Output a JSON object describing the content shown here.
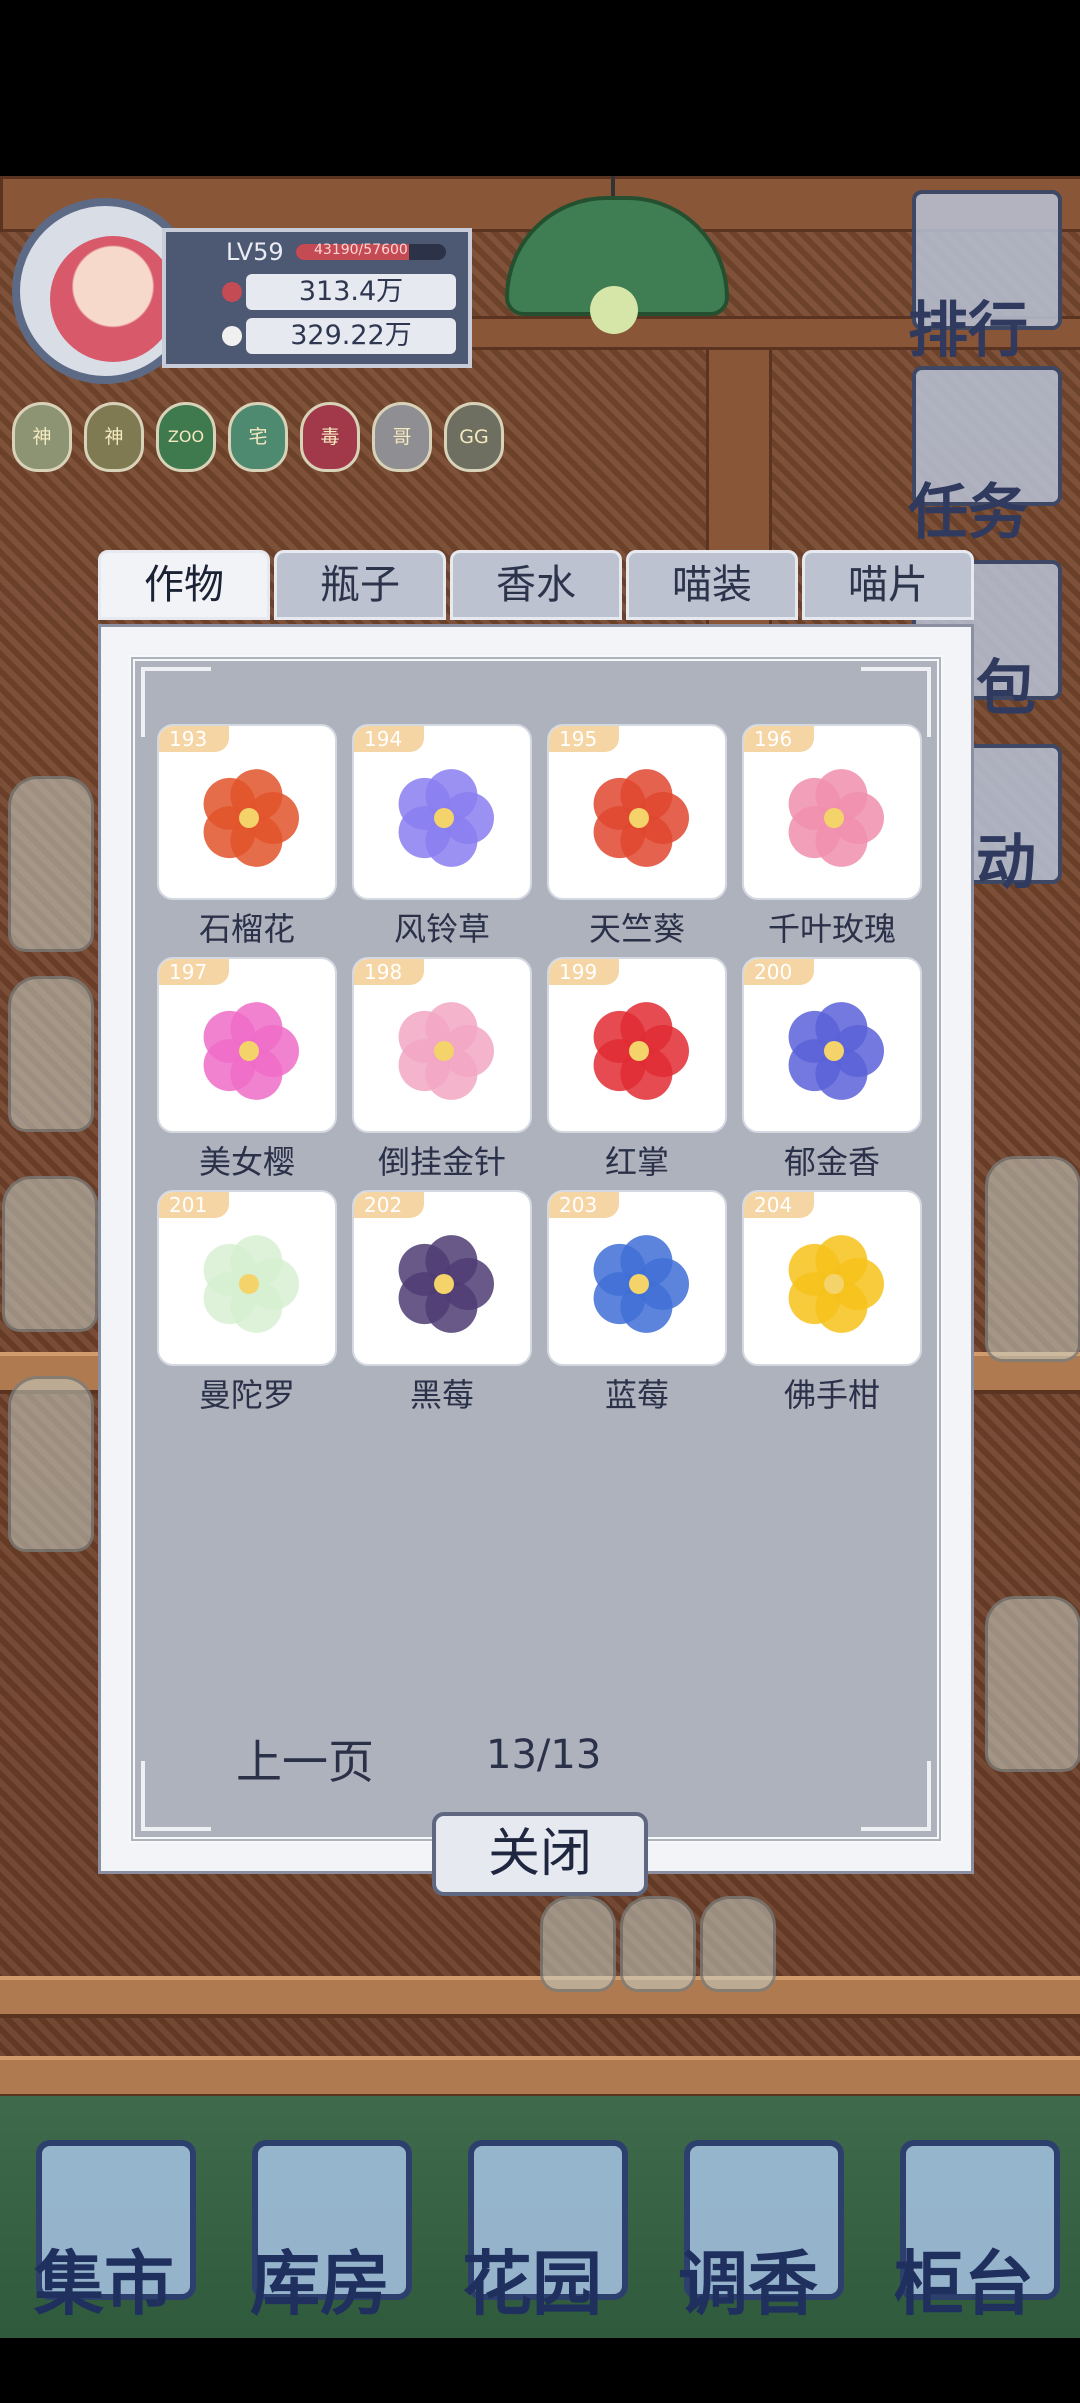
{
  "player": {
    "level": "LV59",
    "xp_text": "43190/57600",
    "xp_fraction": 0.75,
    "currency_1": "313.4万",
    "currency_2": "329.22万"
  },
  "badges": [
    "神",
    "神",
    "ZOO",
    "宅",
    "毒",
    "哥",
    "GG"
  ],
  "side_menu": [
    {
      "label": "排行",
      "icon": "ranking-icon"
    },
    {
      "label": "任务",
      "icon": "task-icon"
    },
    {
      "label": "包",
      "icon": "bag-icon"
    },
    {
      "label": "动",
      "icon": "activity-icon"
    }
  ],
  "tabs": [
    "作物",
    "瓶子",
    "香水",
    "喵装",
    "喵片"
  ],
  "items": [
    {
      "id": "193",
      "name": "石榴花",
      "color": "#e2542a"
    },
    {
      "id": "194",
      "name": "风铃草",
      "color": "#8a7ef0"
    },
    {
      "id": "195",
      "name": "天竺葵",
      "color": "#e0462f"
    },
    {
      "id": "196",
      "name": "千叶玫瑰",
      "color": "#f08fae"
    },
    {
      "id": "197",
      "name": "美女樱",
      "color": "#ef6cc8"
    },
    {
      "id": "198",
      "name": "倒挂金针",
      "color": "#f2a7c3"
    },
    {
      "id": "199",
      "name": "红掌",
      "color": "#e12c33"
    },
    {
      "id": "200",
      "name": "郁金香",
      "color": "#5a61d8"
    },
    {
      "id": "201",
      "name": "曼陀罗",
      "color": "#d7f0d1"
    },
    {
      "id": "202",
      "name": "黑莓",
      "color": "#4f3c74"
    },
    {
      "id": "203",
      "name": "蓝莓",
      "color": "#3f6fd6"
    },
    {
      "id": "204",
      "name": "佛手柑",
      "color": "#f6c21a"
    }
  ],
  "pager": {
    "prev_label": "上一页",
    "page": "13/13"
  },
  "close_label": "关闭",
  "bottom_nav": [
    "集市",
    "库房",
    "花园",
    "调香",
    "柜台"
  ]
}
